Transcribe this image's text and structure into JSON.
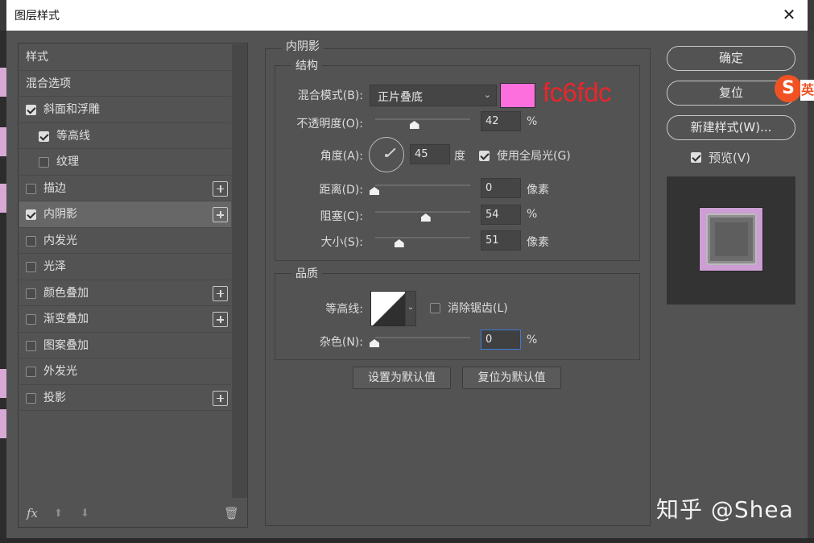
{
  "window": {
    "title": "图层样式",
    "close_glyph": "✕"
  },
  "styles_list": {
    "items": [
      {
        "label": "样式",
        "checkbox": false,
        "checked": false,
        "plus": false
      },
      {
        "label": "混合选项",
        "checkbox": false,
        "checked": false,
        "plus": false
      },
      {
        "label": "斜面和浮雕",
        "checkbox": true,
        "checked": true,
        "plus": false
      },
      {
        "label": "等高线",
        "checkbox": true,
        "checked": true,
        "plus": false,
        "indent": true
      },
      {
        "label": "纹理",
        "checkbox": true,
        "checked": false,
        "plus": false,
        "indent": true
      },
      {
        "label": "描边",
        "checkbox": true,
        "checked": false,
        "plus": true
      },
      {
        "label": "内阴影",
        "checkbox": true,
        "checked": true,
        "plus": true,
        "selected": true
      },
      {
        "label": "内发光",
        "checkbox": true,
        "checked": false,
        "plus": false
      },
      {
        "label": "光泽",
        "checkbox": true,
        "checked": false,
        "plus": false
      },
      {
        "label": "颜色叠加",
        "checkbox": true,
        "checked": false,
        "plus": true
      },
      {
        "label": "渐变叠加",
        "checkbox": true,
        "checked": false,
        "plus": true
      },
      {
        "label": "图案叠加",
        "checkbox": true,
        "checked": false,
        "plus": false
      },
      {
        "label": "外发光",
        "checkbox": true,
        "checked": false,
        "plus": false
      },
      {
        "label": "投影",
        "checkbox": true,
        "checked": false,
        "plus": true
      }
    ],
    "footer": {
      "fx_label": "fx",
      "up_glyph": "⬆",
      "down_glyph": "⬇",
      "trash_glyph": "🗑"
    }
  },
  "inner_shadow": {
    "section_title": "内阴影",
    "structure": {
      "title": "结构",
      "blend_mode_label": "混合模式(B):",
      "blend_mode_value": "正片叠底",
      "color": "#fc6fdc",
      "color_note": "fc6fdc",
      "opacity_label": "不透明度(O):",
      "opacity_value": "42",
      "opacity_fraction": 0.42,
      "opacity_unit": "%",
      "angle_label": "角度(A):",
      "angle_value": "45",
      "angle_unit": "度",
      "global_light_label": "使用全局光(G)",
      "global_light_checked": true,
      "distance_label": "距离(D):",
      "distance_value": "0",
      "distance_fraction": 0.0,
      "distance_unit": "像素",
      "choke_label": "阻塞(C):",
      "choke_value": "54",
      "choke_fraction": 0.54,
      "choke_unit": "%",
      "size_label": "大小(S):",
      "size_value": "51",
      "size_fraction": 0.26,
      "size_unit": "像素"
    },
    "quality": {
      "title": "品质",
      "contour_label": "等高线:",
      "antialias_label": "消除锯齿(L)",
      "antialias_checked": false,
      "noise_label": "杂色(N):",
      "noise_value": "0",
      "noise_fraction": 0.0,
      "noise_unit": "%"
    },
    "make_default_label": "设置为默认值",
    "reset_default_label": "复位为默认值"
  },
  "actions": {
    "ok_label": "确定",
    "reset_label": "复位",
    "new_style_label": "新建样式(W)...",
    "preview_label": "预览(V)",
    "preview_checked": true
  },
  "overlays": {
    "ime_icon_letter": "S",
    "ime_tab_letter": "英",
    "watermark": "知乎 @Shea"
  }
}
